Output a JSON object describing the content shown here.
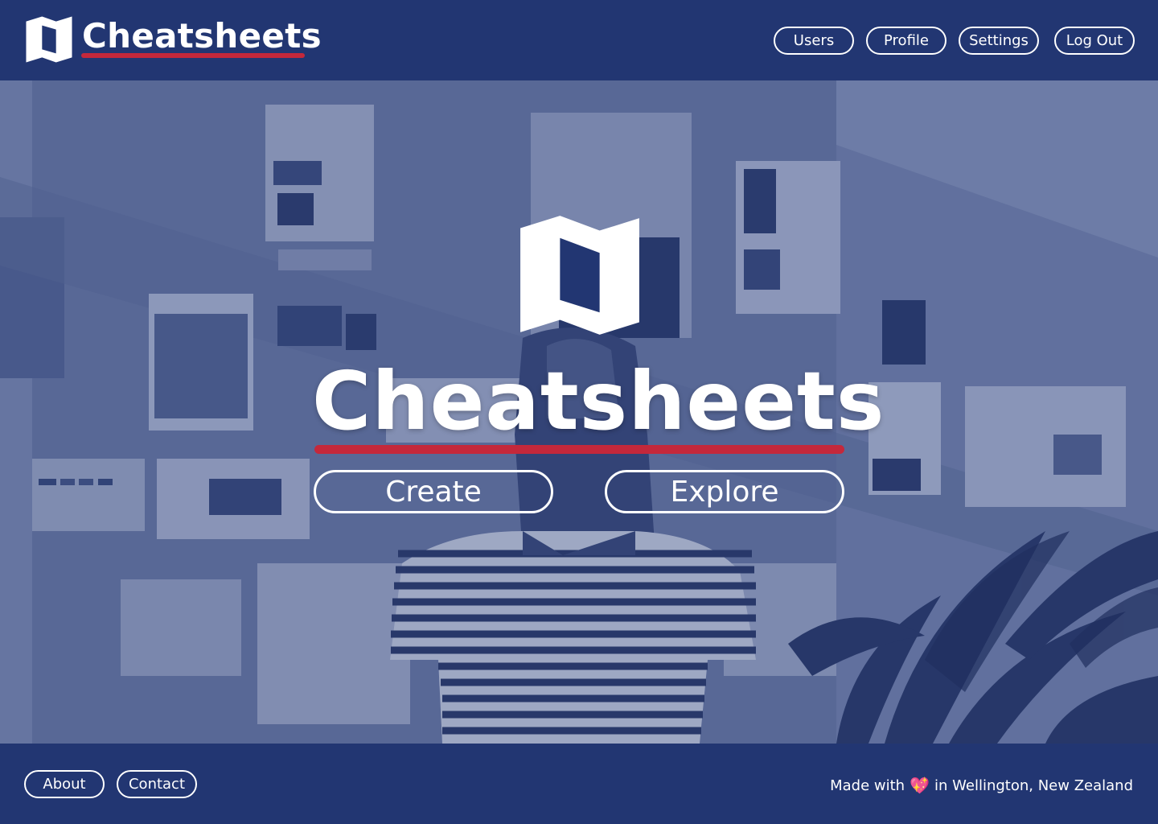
{
  "header": {
    "brand_name": "Cheatsheets",
    "logo_icon": "folded-map-icon",
    "nav": [
      {
        "label": "Users"
      },
      {
        "label": "Profile"
      },
      {
        "label": "Settings"
      },
      {
        "label": "Log Out"
      }
    ]
  },
  "hero": {
    "logo_icon": "folded-map-icon",
    "title": "Cheatsheets",
    "background": "photo of a woman in a striped t-shirt facing a wall of pinned posters, with a potted plant, tinted blue",
    "create_label": "Create",
    "explore_label": "Explore"
  },
  "footer": {
    "about_label": "About",
    "contact_label": "Contact",
    "credit_prefix": "Made with",
    "credit_icon": "sparkling-heart-icon",
    "credit_suffix": "in Wellington, New Zealand"
  },
  "colors": {
    "primary": "#223672",
    "accent": "#c4283b",
    "text": "#ffffff"
  }
}
